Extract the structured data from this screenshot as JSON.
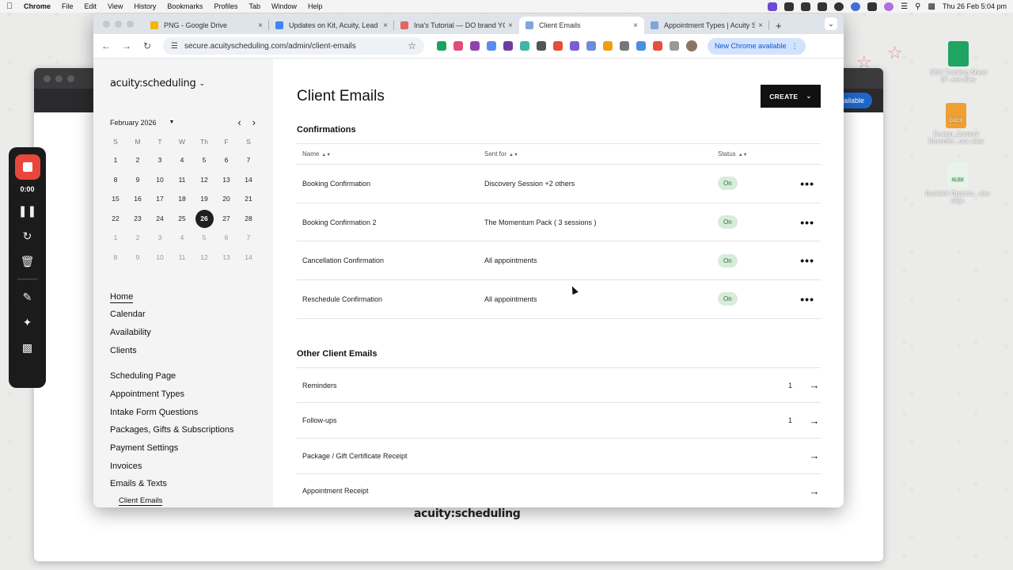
{
  "menubar": {
    "app": "Chrome",
    "items": [
      "File",
      "Edit",
      "View",
      "History",
      "Bookmarks",
      "Profiles",
      "Tab",
      "Window",
      "Help"
    ],
    "clock": "Thu 26 Feb  5:04 pm"
  },
  "recorder": {
    "time": "0:00"
  },
  "desktop_files": [
    {
      "name": "SEO Tracking Sheet (P...eet alias",
      "color": "#1fa463"
    },
    {
      "name": "Design_Content Recomm...ocx alias",
      "color": "#f0a030",
      "tag": "DOCX"
    },
    {
      "name": "Backlink Opportu...xlsx alias",
      "color": "#24a148",
      "tag": "XLSX"
    }
  ],
  "browser": {
    "tabs": [
      {
        "label": "PNG - Google Drive",
        "color": "#f4b400"
      },
      {
        "label": "Updates on Kit, Acuity, Lead",
        "color": "#4285f4"
      },
      {
        "label": "Ina's Tutorial — DO brand YOU",
        "color": "#e06666"
      },
      {
        "label": "Client Emails",
        "color": "#7fa7d9",
        "active": true
      },
      {
        "label": "Appointment Types | Acuity S",
        "color": "#7fa7d9"
      }
    ],
    "url": "secure.acuityscheduling.com/admin/client-emails",
    "update_label": "New Chrome available"
  },
  "background_window": {
    "update_label": "vailable",
    "footer_logo": "acuity:scheduling"
  },
  "sidebar": {
    "brand": "acuity:scheduling",
    "calendar": {
      "month": "February 2026",
      "weekdays": [
        "S",
        "M",
        "T",
        "W",
        "Th",
        "F",
        "S"
      ],
      "weeks": [
        [
          "1",
          "2",
          "3",
          "4",
          "5",
          "6",
          "7"
        ],
        [
          "8",
          "9",
          "10",
          "11",
          "12",
          "13",
          "14"
        ],
        [
          "15",
          "16",
          "17",
          "18",
          "19",
          "20",
          "21"
        ],
        [
          "22",
          "23",
          "24",
          "25",
          "26",
          "27",
          "28"
        ],
        [
          "1",
          "2",
          "3",
          "4",
          "5",
          "6",
          "7"
        ],
        [
          "8",
          "9",
          "10",
          "11",
          "12",
          "13",
          "14"
        ]
      ],
      "selected": "26"
    },
    "nav_primary": [
      "Home",
      "Calendar",
      "Availability",
      "Clients"
    ],
    "nav_secondary": [
      "Scheduling Page",
      "Appointment Types",
      "Intake Form Questions",
      "Packages, Gifts & Subscriptions",
      "Payment Settings",
      "Invoices",
      "Emails & Texts"
    ],
    "nav_sub": "Client Emails",
    "active_item": "Home"
  },
  "main": {
    "title": "Client Emails",
    "create_label": "CREATE",
    "confirmations": {
      "heading": "Confirmations",
      "columns": {
        "name": "Name",
        "sent_for": "Sent for",
        "status": "Status"
      },
      "rows": [
        {
          "name": "Booking Confirmation",
          "sent_for": "Discovery Session +2 others",
          "status": "On"
        },
        {
          "name": "Booking Confirmation 2",
          "sent_for": "The Momentum Pack ( 3 sessions )",
          "status": "On"
        },
        {
          "name": "Cancellation Confirmation",
          "sent_for": "All appointments",
          "status": "On"
        },
        {
          "name": "Reschedule Confirmation",
          "sent_for": "All appointments",
          "status": "On"
        }
      ]
    },
    "other": {
      "heading": "Other Client Emails",
      "rows": [
        {
          "label": "Reminders",
          "count": "1"
        },
        {
          "label": "Follow-ups",
          "count": "1"
        },
        {
          "label": "Package / Gift Certificate Receipt",
          "count": ""
        },
        {
          "label": "Appointment Receipt",
          "count": ""
        }
      ]
    }
  }
}
